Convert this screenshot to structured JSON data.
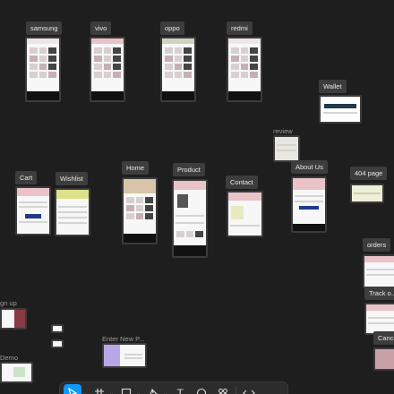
{
  "canvas": {
    "frames": {
      "samsung": "samsung",
      "vivo": "vivo",
      "oppo": "oppo",
      "redmi": "redmi",
      "wallet": "Wallet",
      "review": "review",
      "cart": "Cart",
      "wishlist": "Wishlist",
      "home": "Home",
      "product": "Product",
      "contact": "Contact",
      "about_us": "About Us",
      "page_404": "404 page",
      "orders": "orders",
      "track": "Track o...",
      "cancel": "Cance",
      "sign_up": "gn up",
      "enter_new_p": "Enter New P...",
      "demo": "Demo"
    }
  },
  "toolbar": {
    "tools": [
      {
        "name": "move-tool",
        "icon": "cursor-icon",
        "active": true
      },
      {
        "name": "frame-tool",
        "icon": "hash-icon",
        "active": false
      },
      {
        "name": "shape-tool",
        "icon": "square-icon",
        "active": false
      },
      {
        "name": "pen-tool",
        "icon": "pen-icon",
        "active": false
      },
      {
        "name": "text-tool",
        "icon": "text-icon",
        "active": false
      },
      {
        "name": "comment-tool",
        "icon": "comment-icon",
        "active": false
      },
      {
        "name": "resources-tool",
        "icon": "components-icon",
        "active": false
      },
      {
        "name": "dev-mode-toggle",
        "icon": "code-icon",
        "active": false
      }
    ],
    "glyphs": {
      "text": "T",
      "caret": "⌄"
    }
  },
  "colors": {
    "canvas": "#1e1e1e",
    "label_bg": "#3d3d3d",
    "accent": "#0d99ff"
  }
}
